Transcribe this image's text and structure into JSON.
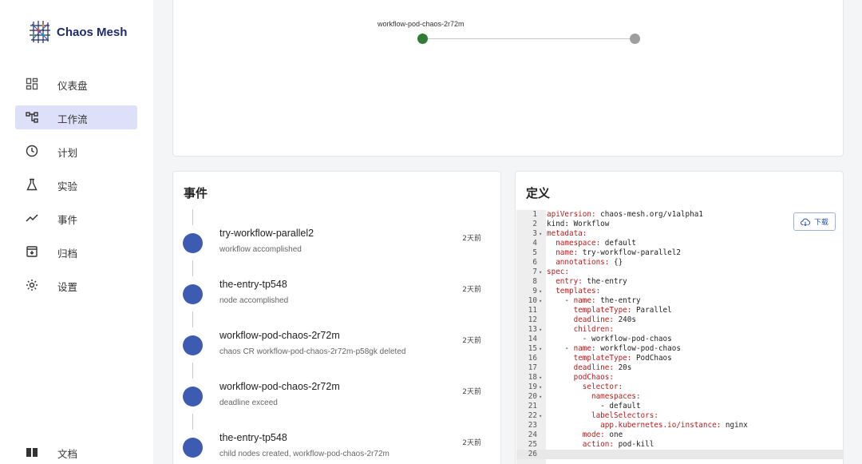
{
  "app": {
    "name": "Chaos Mesh"
  },
  "sidebar": {
    "items": [
      {
        "label": "仪表盘",
        "icon": "dashboard-icon"
      },
      {
        "label": "工作流",
        "icon": "workflow-icon",
        "active": true
      },
      {
        "label": "计划",
        "icon": "clock-icon"
      },
      {
        "label": "实验",
        "icon": "flask-icon"
      },
      {
        "label": "事件",
        "icon": "trend-icon"
      },
      {
        "label": "归档",
        "icon": "archive-icon"
      },
      {
        "label": "设置",
        "icon": "gear-icon"
      }
    ],
    "docs": {
      "label": "文档",
      "icon": "book-icon"
    }
  },
  "graph": {
    "node_label": "workflow-pod-chaos-2r72m",
    "colors": {
      "done": "#2e7d32",
      "pending": "#9e9e9e"
    }
  },
  "events": {
    "title": "事件",
    "items": [
      {
        "name": "try-workflow-parallel2",
        "message": "workflow accomplished",
        "time": "2天前"
      },
      {
        "name": "the-entry-tp548",
        "message": "node accomplished",
        "time": "2天前"
      },
      {
        "name": "workflow-pod-chaos-2r72m",
        "message": "chaos CR workflow-pod-chaos-2r72m-p58gk deleted",
        "time": "2天前"
      },
      {
        "name": "workflow-pod-chaos-2r72m",
        "message": "deadline exceed",
        "time": "2天前"
      },
      {
        "name": "the-entry-tp548",
        "message": "child nodes created, workflow-pod-chaos-2r72m",
        "time": "2天前"
      }
    ]
  },
  "definition": {
    "title": "定义",
    "download_label": "下载",
    "lines": [
      {
        "n": "1",
        "fold": "",
        "indent": "",
        "key": "apiVersion:",
        "val": " chaos-mesh.org/v1alpha1",
        "plain": false
      },
      {
        "n": "2",
        "fold": "",
        "indent": "",
        "key": "",
        "val": "kind: Workflow",
        "plain": true
      },
      {
        "n": "3",
        "fold": "▾",
        "indent": "",
        "key": "metadata:",
        "val": "",
        "plain": false
      },
      {
        "n": "4",
        "fold": "",
        "indent": "  ",
        "key": "namespace:",
        "val": " default",
        "plain": false
      },
      {
        "n": "5",
        "fold": "",
        "indent": "  ",
        "key": "name:",
        "val": " try-workflow-parallel2",
        "plain": false
      },
      {
        "n": "6",
        "fold": "",
        "indent": "  ",
        "key": "annotations:",
        "val": " {}",
        "plain": false
      },
      {
        "n": "7",
        "fold": "▾",
        "indent": "",
        "key": "spec:",
        "val": "",
        "plain": false
      },
      {
        "n": "8",
        "fold": "",
        "indent": "  ",
        "key": "entry:",
        "val": " the-entry",
        "plain": false
      },
      {
        "n": "9",
        "fold": "▾",
        "indent": "  ",
        "key": "templates:",
        "val": "",
        "plain": false
      },
      {
        "n": "10",
        "fold": "▾",
        "indent": "    - ",
        "key": "name:",
        "val": " the-entry",
        "plain": false
      },
      {
        "n": "11",
        "fold": "",
        "indent": "      ",
        "key": "templateType:",
        "val": " Parallel",
        "plain": false
      },
      {
        "n": "12",
        "fold": "",
        "indent": "      ",
        "key": "deadline:",
        "val": " 240s",
        "plain": false
      },
      {
        "n": "13",
        "fold": "▾",
        "indent": "      ",
        "key": "children:",
        "val": "",
        "plain": false
      },
      {
        "n": "14",
        "fold": "",
        "indent": "        ",
        "key": "",
        "val": "- workflow-pod-chaos",
        "plain": true
      },
      {
        "n": "15",
        "fold": "▾",
        "indent": "    - ",
        "key": "name:",
        "val": " workflow-pod-chaos",
        "plain": false
      },
      {
        "n": "16",
        "fold": "",
        "indent": "      ",
        "key": "templateType:",
        "val": " PodChaos",
        "plain": false
      },
      {
        "n": "17",
        "fold": "",
        "indent": "      ",
        "key": "deadline:",
        "val": " 20s",
        "plain": false
      },
      {
        "n": "18",
        "fold": "▾",
        "indent": "      ",
        "key": "podChaos:",
        "val": "",
        "plain": false
      },
      {
        "n": "19",
        "fold": "▾",
        "indent": "        ",
        "key": "selector:",
        "val": "",
        "plain": false
      },
      {
        "n": "20",
        "fold": "▾",
        "indent": "          ",
        "key": "namespaces:",
        "val": "",
        "plain": false
      },
      {
        "n": "21",
        "fold": "",
        "indent": "            ",
        "key": "",
        "val": "- default",
        "plain": true
      },
      {
        "n": "22",
        "fold": "▾",
        "indent": "          ",
        "key": "labelSelectors:",
        "val": "",
        "plain": false
      },
      {
        "n": "23",
        "fold": "",
        "indent": "            ",
        "key": "app.kubernetes.io/instance:",
        "val": " nginx",
        "plain": false
      },
      {
        "n": "24",
        "fold": "",
        "indent": "        ",
        "key": "mode:",
        "val": " one",
        "plain": false
      },
      {
        "n": "25",
        "fold": "",
        "indent": "        ",
        "key": "action:",
        "val": " pod-kill",
        "plain": false
      },
      {
        "n": "26",
        "fold": "",
        "indent": "",
        "key": "",
        "val": "",
        "plain": true
      }
    ]
  }
}
